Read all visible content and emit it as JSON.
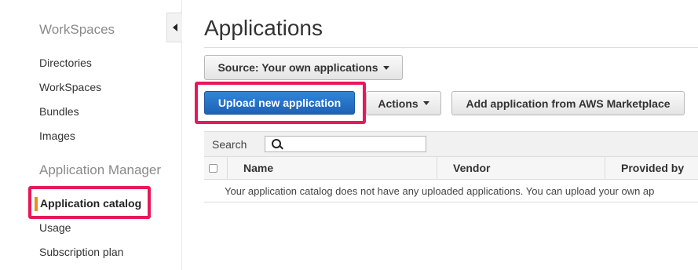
{
  "sidebar": {
    "sections": [
      {
        "title": "WorkSpaces",
        "items": [
          "Directories",
          "WorkSpaces",
          "Bundles",
          "Images"
        ]
      },
      {
        "title": "Application Manager",
        "items": [
          "Application catalog",
          "Usage",
          "Subscription plan"
        ]
      }
    ],
    "active_item": "Application catalog"
  },
  "main": {
    "title": "Applications",
    "source_dropdown": "Source: Your own applications",
    "buttons": {
      "upload": "Upload new application",
      "actions": "Actions",
      "marketplace": "Add application from AWS Marketplace"
    },
    "search": {
      "label": "Search",
      "value": ""
    },
    "table": {
      "columns": [
        "Name",
        "Vendor",
        "Provided by"
      ],
      "empty_message": "Your application catalog does not have any uploaded applications. You can upload your own ap"
    }
  },
  "colors": {
    "highlight": "#e8185a",
    "primary": "#1f62b5",
    "active_marker": "#e88f1e"
  }
}
